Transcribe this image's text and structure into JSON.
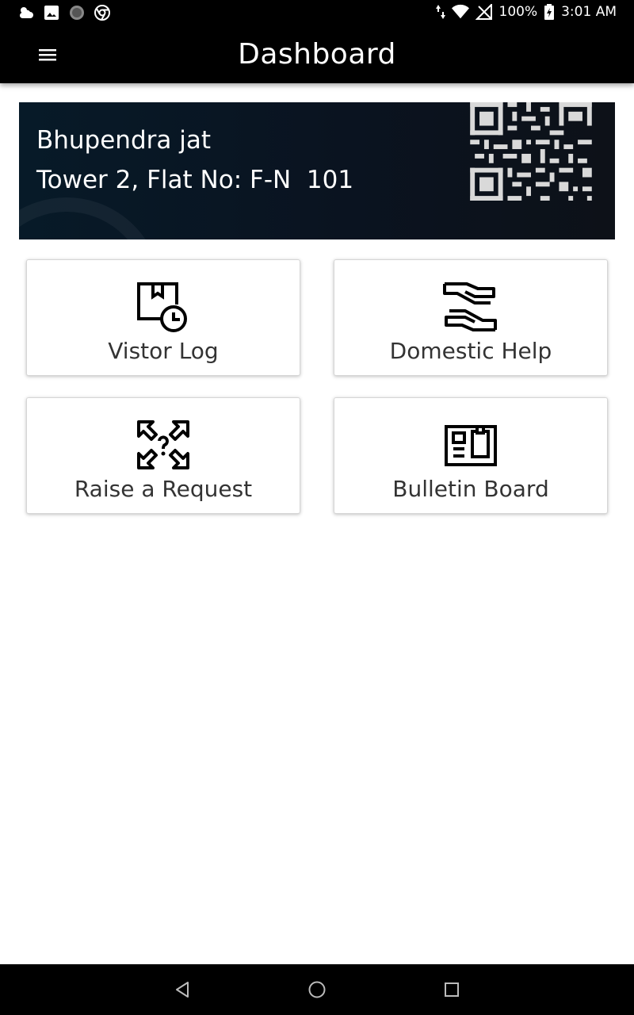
{
  "status_bar": {
    "battery": "100%",
    "time": "3:01 AM",
    "left_icons": [
      "weather-icon",
      "gallery-icon",
      "circle-icon",
      "chrome-icon"
    ],
    "right_icons": [
      "data-arrows-icon",
      "wifi-icon",
      "no-signal-icon",
      "battery-charging-icon"
    ]
  },
  "app_bar": {
    "title": "Dashboard",
    "menu_icon": "menu-icon"
  },
  "profile": {
    "name": "Bhupendra jat",
    "address": "Tower 2, Flat No: F-N  101",
    "qr_icon": "qr-code-icon"
  },
  "tiles": [
    {
      "label": "Vistor Log",
      "icon": "box-clock-icon"
    },
    {
      "label": "Domestic Help",
      "icon": "helping-hands-icon"
    },
    {
      "label": "Raise a Request",
      "icon": "question-arrows-icon"
    },
    {
      "label": "Bulletin Board",
      "icon": "bulletin-board-icon"
    }
  ],
  "nav_bar": {
    "buttons": [
      "back-icon",
      "home-icon",
      "recents-icon"
    ]
  },
  "colors": {
    "bar_background": "#000000",
    "card_background": "#0a1320",
    "tile_text": "#333333",
    "page_background": "#ffffff"
  }
}
